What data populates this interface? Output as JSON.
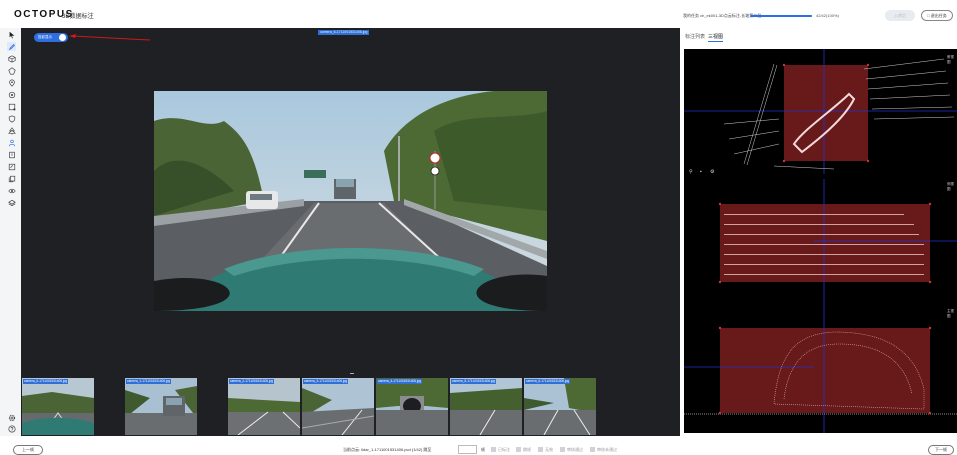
{
  "header": {
    "brand": "OCTOPUS",
    "subtitle": "3D数据标注",
    "task_label": "我的任务 ch_ek001-3D点云标注-长坡第二批",
    "progress_text": "42/42(100%)",
    "progress_fraction": 1.0,
    "enter_button": "入库后",
    "exit_button": "□ 退出任务"
  },
  "toolbar": {
    "icons": [
      "pointer-icon",
      "pencil-icon",
      "cuboid-icon",
      "polygon-icon",
      "point-icon",
      "target-icon",
      "box-select-icon",
      "shield-icon",
      "tree-icon",
      "person-icon",
      "frame-icon",
      "note-icon",
      "copy-icon",
      "eye-icon",
      "layers-icon"
    ],
    "bottom_icons": [
      "settings-icon",
      "help-icon"
    ]
  },
  "canvas": {
    "camera_tag": "camera_6-1711001531406.jpg",
    "toggle_label": "投影显示",
    "toggle_on": true
  },
  "thumbnails": [
    {
      "label": "camera_0-1711001531406.jpg"
    },
    {
      "label": "camera_1-1711001531406.jpg"
    },
    {
      "label": "camera_2-1711001531406.jpg"
    },
    {
      "label": "camera_3-1711001531406.jpg"
    },
    {
      "label": "camera_4-1711001531406.jpg"
    },
    {
      "label": "camera_5-1711001531406.jpg"
    },
    {
      "label": "camera_6-1711001531406.jpg"
    }
  ],
  "right_panel": {
    "tabs": [
      "标注列表",
      "三视图"
    ],
    "active_tab": "三视图",
    "view_labels": [
      "俯视图",
      "侧视图",
      "主视图"
    ]
  },
  "footer": {
    "prev_button": "上一帧",
    "next_button": "下一帧",
    "info": "当前点云: lidar_1-1711001531406.pcd (1/42)  跳至",
    "jump_after": "帧",
    "filters": [
      "已标注",
      "跳帧",
      "无效",
      "审核通过",
      "审核未通过"
    ]
  },
  "colors": {
    "accent": "#2d6fe0",
    "box_fill": "#7a1d1d",
    "canvas_bg": "#1f2023"
  }
}
